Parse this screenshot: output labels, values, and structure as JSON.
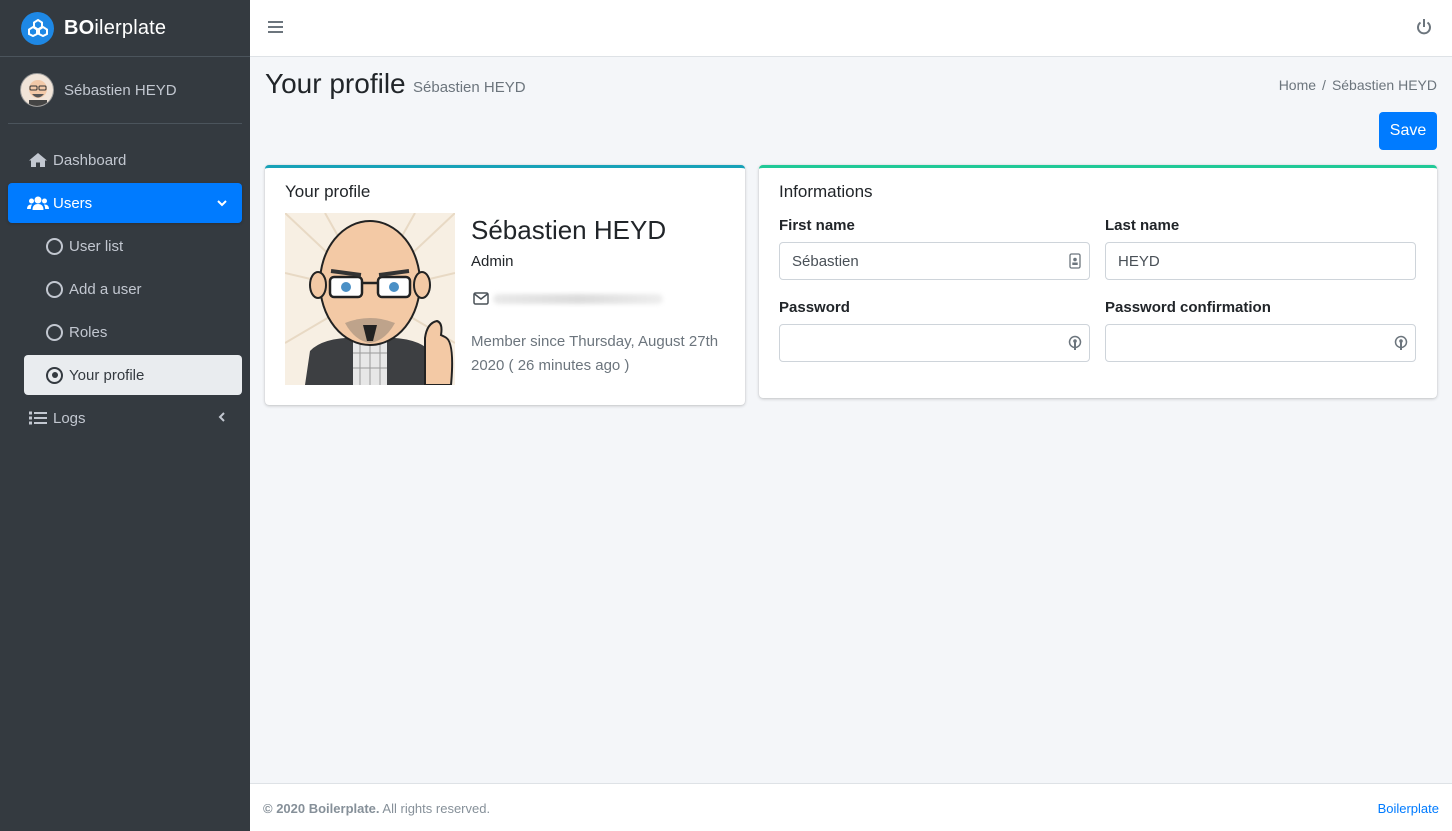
{
  "brand": {
    "bold": "BO",
    "rest": "ilerplate"
  },
  "user_panel": {
    "name": "Sébastien HEYD"
  },
  "nav": {
    "dashboard": "Dashboard",
    "users": "Users",
    "user_list": "User list",
    "add_user": "Add a user",
    "roles": "Roles",
    "your_profile": "Your profile",
    "logs": "Logs"
  },
  "header": {
    "title": "Your profile",
    "subtitle": "Sébastien HEYD",
    "breadcrumb": {
      "home": "Home",
      "separator": "/",
      "current": "Sébastien HEYD"
    },
    "save_label": "Save"
  },
  "profile_card": {
    "title": "Your profile",
    "name": "Sébastien HEYD",
    "role": "Admin",
    "member_since": "Member since Thursday, August 27th 2020 ( 26 minutes ago )"
  },
  "info_card": {
    "title": "Informations",
    "first_name_label": "First name",
    "first_name_value": "Sébastien",
    "last_name_label": "Last name",
    "last_name_value": "HEYD",
    "password_label": "Password",
    "password_confirmation_label": "Password confirmation"
  },
  "footer": {
    "copyright": "© 2020 Boilerplate.",
    "rights": " All rights reserved.",
    "link": "Boilerplate"
  },
  "colors": {
    "accent": "#007bff",
    "sidebar": "#343a40",
    "profile_border": "#17a2b8",
    "info_border": "#20c997"
  }
}
